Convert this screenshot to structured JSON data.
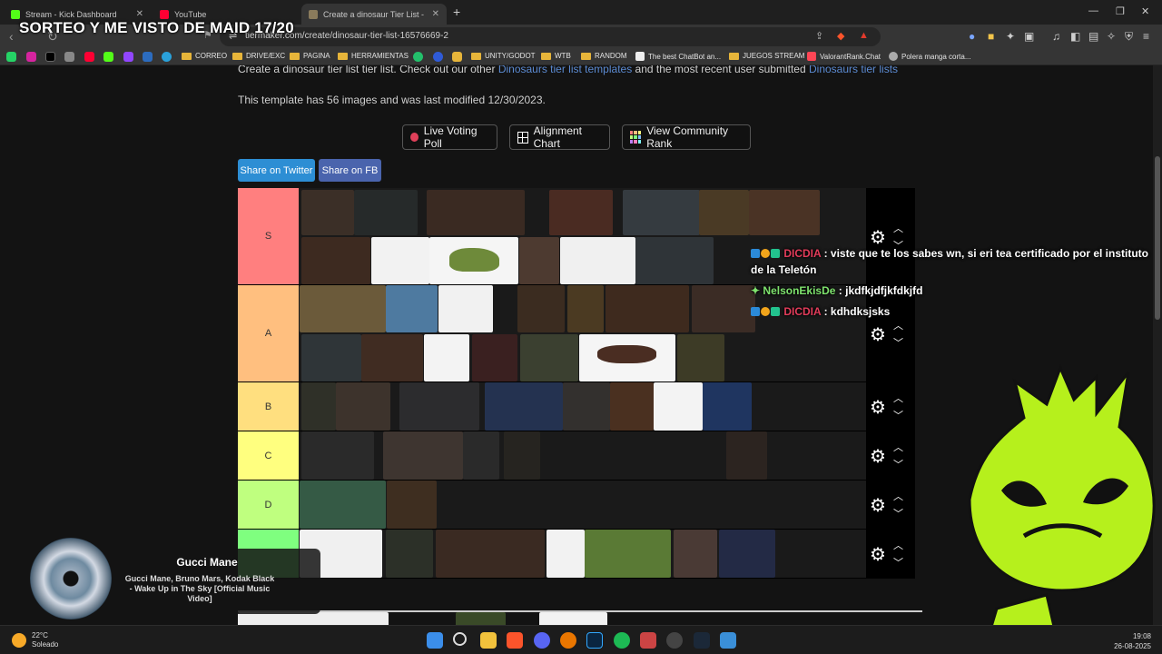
{
  "browser": {
    "tabs": [
      {
        "title": "Stream - Kick Dashboard",
        "color": "#53fc18"
      },
      {
        "title": "YouTube",
        "color": "#ff0033"
      },
      {
        "title": "Create a dinosaur Tier List - Tier",
        "color": "#8a7b5c"
      }
    ],
    "address": "tiermaker.com/create/dinosaur-tier-list-16576669-2",
    "overlay_title": "SORTEO Y ME VISTO DE MAID 17/20"
  },
  "bookmarks": [
    "CORREO",
    "DRIVE/EXC",
    "PAGINA",
    "HERRAMIENTAS",
    "UNITY/GODOT",
    "WTB",
    "RANDOM",
    "The best ChatBot an...",
    "JUEGOS STREAM",
    "ValorantRank.Chat",
    "Polera manga corta..."
  ],
  "page": {
    "intro_prefix": "Create a dinosaur tier list tier list. Check out our other",
    "intro_link1": "Dinosaurs tier list templates",
    "intro_mid": "and the most recent user submitted",
    "intro_link2": "Dinosaurs tier lists",
    "template_info": "This template has 56 images and was last modified 12/30/2023.",
    "buttons": {
      "live_voting": "Live Voting Poll",
      "alignment": "Alignment Chart",
      "community": "View Community Rank",
      "share_twitter": "Share on Twitter",
      "share_fb": "Share on FB"
    }
  },
  "tiers": [
    {
      "label": "S",
      "color": "#ff7f7f"
    },
    {
      "label": "A",
      "color": "#ffbf7f"
    },
    {
      "label": "B",
      "color": "#ffdf7f"
    },
    {
      "label": "C",
      "color": "#ffff7f"
    },
    {
      "label": "D",
      "color": "#bfff7f"
    },
    {
      "label": "",
      "color": "#7fff7f"
    }
  ],
  "chat": [
    {
      "user": "DICDIA",
      "message": ": viste que te los sabes wn, si eri tea certificado por el instituto de la Teletón"
    },
    {
      "user": "NelsonEkisDe",
      "message": ": jkdfkjdfjkfdkjfd"
    },
    {
      "user": "DICDIA",
      "message": ": kdhdksjsks"
    }
  ],
  "music": {
    "artist": "Gucci Mane",
    "song": "Gucci Mane, Bruno Mars, Kodak Black - Wake Up in The Sky [Official Music Video]"
  },
  "taskbar": {
    "temperature": "22°C",
    "weather": "Soleado",
    "time": "19:08",
    "date": "26-08-2025"
  }
}
